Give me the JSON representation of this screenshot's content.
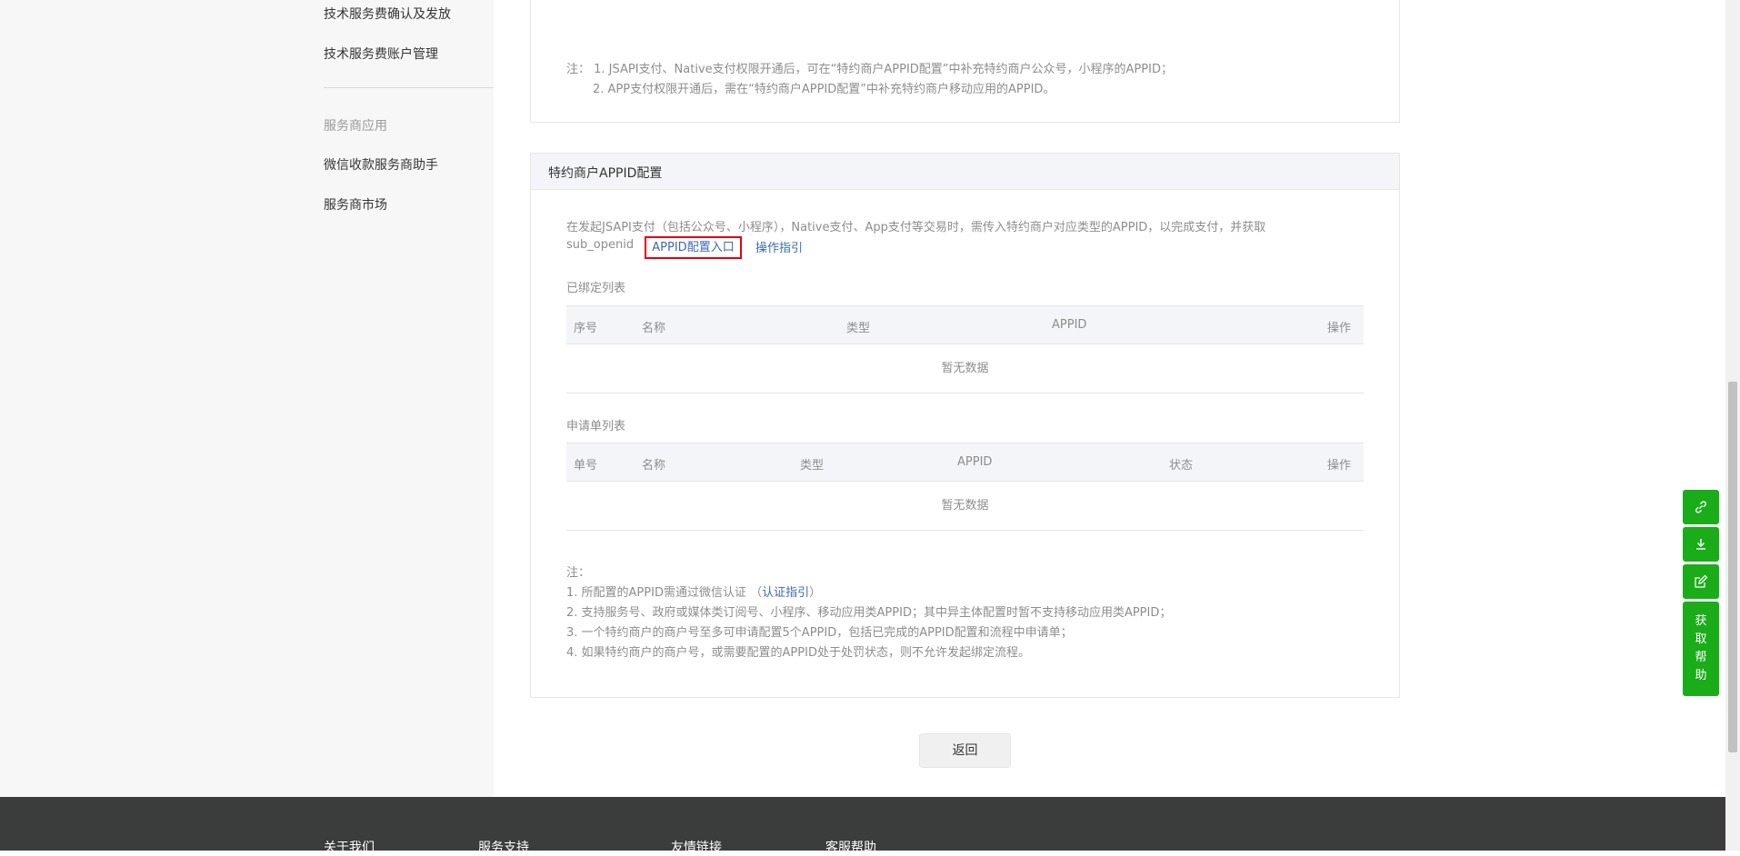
{
  "sidebar": {
    "items_top": [
      "技术服务费确认及发放",
      "技术服务费账户管理"
    ],
    "group_title": "服务商应用",
    "items_bottom": [
      "微信收款服务商助手",
      "服务商市场"
    ]
  },
  "top_notes": {
    "line1": "注：  1. JSAPI支付、Native支付权限开通后，可在“特约商户APPID配置”中补充特约商户公众号，小程序的APPID；",
    "line2": "2. APP支付权限开通后，需在“特约商户APPID配置”中补充特约商户移动应用的APPID。"
  },
  "appid_panel": {
    "title": "特约商户APPID配置",
    "description_line1": "在发起JSAPI支付（包括公众号、小程序），Native支付、App支付等交易时，需传入特约商户对应类型的APPID，以完成支付，并获取",
    "description_line2": "sub_openid",
    "config_link": "APPID配置入口",
    "guide_link": "操作指引",
    "bound_list": {
      "label": "已绑定列表",
      "columns": [
        "序号",
        "名称",
        "类型",
        "APPID",
        "操作"
      ],
      "empty_text": "暂无数据"
    },
    "apply_list": {
      "label": "申请单列表",
      "columns": [
        "单号",
        "名称",
        "类型",
        "APPID",
        "状态",
        "操作"
      ],
      "empty_text": "暂无数据"
    },
    "notes": {
      "title": "注：",
      "n1_prefix": "1. 所配置的APPID需通过微信认证 （",
      "n1_link": "认证指引",
      "n1_suffix": "）",
      "n2": "2. 支持服务号、政府或媒体类订阅号、小程序、移动应用类APPID；其中异主体配置时暂不支持移动应用类APPID；",
      "n3": "3. 一个特约商户的商户号至多可申请配置5个APPID，包括已完成的APPID配置和流程中申请单；",
      "n4": "4. 如果特约商户的商户号，或需要配置的APPID处于处罚状态，则不允许发起绑定流程。"
    }
  },
  "back_button": "返回",
  "footer": {
    "links": [
      "关于我们",
      "服务支持",
      "友情链接",
      "客服帮助"
    ]
  },
  "float_tools": {
    "icons": [
      "link-icon",
      "download-icon",
      "edit-icon"
    ],
    "help_label": "获取帮助",
    "color": "#1aad19"
  },
  "colors": {
    "link": "#3a6bb1",
    "highlight_border": "#e60012",
    "footer_bg": "#3b3d3d"
  }
}
